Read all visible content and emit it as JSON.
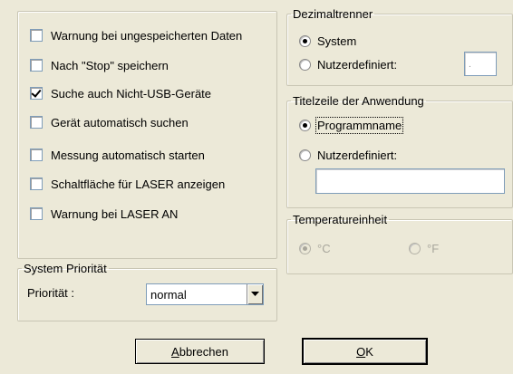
{
  "options": {
    "items": [
      {
        "label": "Warnung bei ungespeicherten Daten",
        "checked": false
      },
      {
        "label": "Nach \"Stop\" speichern",
        "checked": false
      },
      {
        "label": "Suche auch Nicht-USB-Geräte",
        "checked": true
      },
      {
        "label": "Gerät automatisch suchen",
        "checked": false
      },
      {
        "label": "Messung automatisch starten",
        "checked": false
      },
      {
        "label": "Schaltfläche für LASER anzeigen",
        "checked": false
      },
      {
        "label": "Warnung bei LASER AN",
        "checked": false
      }
    ]
  },
  "priority": {
    "legend": "System Priorität",
    "label": "Priorität :",
    "selected": "normal"
  },
  "decimal": {
    "legend": "Dezimaltrenner",
    "system_label": "System",
    "custom_label": "Nutzerdefiniert:",
    "custom_value": ".",
    "selected": "system"
  },
  "title_bar": {
    "legend": "Titelzeile der Anwendung",
    "program_label": "Programmname",
    "custom_label": "Nutzerdefiniert:",
    "custom_value": "",
    "selected": "program"
  },
  "temperature": {
    "legend": "Temperatureinheit",
    "celsius_label": "°C",
    "fahrenheit_label": "°F",
    "selected": "celsius"
  },
  "buttons": {
    "cancel_label": "Abbrechen",
    "ok_label": "OK"
  },
  "colors": {
    "dialog_background": "#ece9d8",
    "disabled_text": "#a8a69c"
  }
}
